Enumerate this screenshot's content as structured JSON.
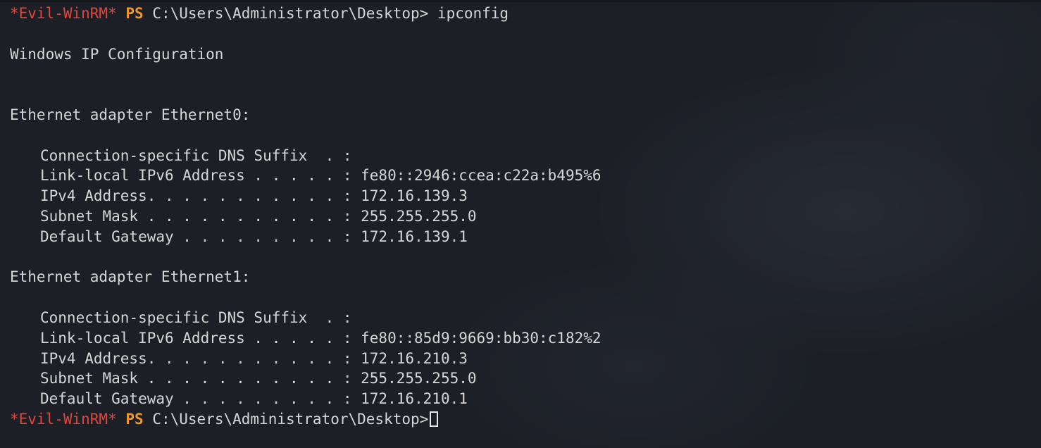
{
  "prompt": {
    "shell_tag": "*Evil-WinRM*",
    "ps": "PS",
    "path": "C:\\Users\\Administrator\\Desktop>"
  },
  "command": "ipconfig",
  "header": "Windows IP Configuration",
  "adapters": [
    {
      "title": "Ethernet adapter Ethernet0:",
      "lines": [
        "Connection-specific DNS Suffix  . :",
        "Link-local IPv6 Address . . . . . : fe80::2946:ccea:c22a:b495%6",
        "IPv4 Address. . . . . . . . . . . : 172.16.139.3",
        "Subnet Mask . . . . . . . . . . . : 255.255.255.0",
        "Default Gateway . . . . . . . . . : 172.16.139.1"
      ]
    },
    {
      "title": "Ethernet adapter Ethernet1:",
      "lines": [
        "Connection-specific DNS Suffix  . :",
        "Link-local IPv6 Address . . . . . : fe80::85d9:9669:bb30:c182%2",
        "IPv4 Address. . . . . . . . . . . : 172.16.210.3",
        "Subnet Mask . . . . . . . . . . . : 255.255.255.0",
        "Default Gateway . . . . . . . . . : 172.16.210.1"
      ]
    }
  ],
  "colors": {
    "background": "#1c1f26",
    "text": "#d6d6d6",
    "shell_tag": "#e0463c",
    "ps": "#f0952a"
  }
}
